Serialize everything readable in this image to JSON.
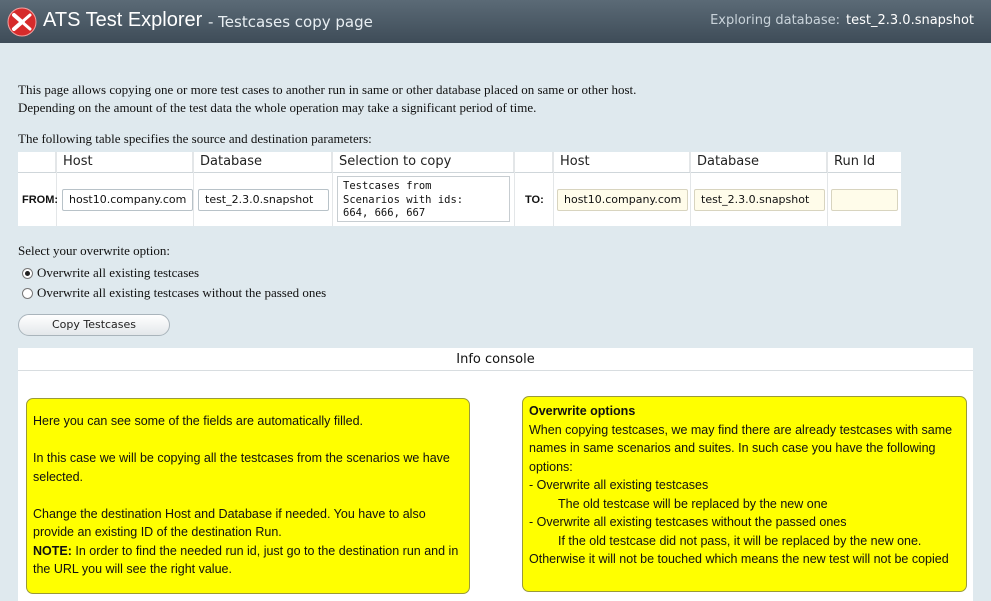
{
  "header": {
    "app_title": "ATS Test Explorer",
    "page_subtitle": "- Testcases copy page",
    "db_label": "Exploring database:",
    "db_name": "test_2.3.0.snapshot"
  },
  "intro": {
    "line1": "This page allows copying one or more test cases to another run in same or other database placed on same or other host.",
    "line2": "Depending on the amount of the test data the whole operation may take a significant period of time."
  },
  "table_caption": "The following table specifies the source and destination parameters:",
  "params": {
    "headers": {
      "src_host": "Host",
      "src_db": "Database",
      "selection": "Selection to copy",
      "dst_host": "Host",
      "dst_db": "Database",
      "run_id": "Run Id"
    },
    "from_label": "FROM:",
    "to_label": "TO:",
    "from_host": "host10.company.com",
    "from_db": "test_2.3.0.snapshot",
    "selection_text": "Testcases from\nScenarios with ids:\n664, 666, 667",
    "to_host": "host10.company.com",
    "to_db": "test_2.3.0.snapshot",
    "run_id": ""
  },
  "overwrite": {
    "title": "Select your overwrite option:",
    "options": [
      {
        "label": "Overwrite all existing testcases",
        "selected": true
      },
      {
        "label": "Overwrite all existing testcases without the passed ones",
        "selected": false
      }
    ]
  },
  "copy_button": "Copy Testcases",
  "console": {
    "title": "Info console",
    "left_note": {
      "p1": "Here you can see some of the fields are automatically filled.",
      "p2": "In this case we will be copying all the testcases from the scenarios we have selected.",
      "p3": "Change the destination Host and Database if needed. You have to also provide an existing ID of the destination Run.",
      "p4_label": "NOTE:",
      "p4_text": " In order to find the needed run id, just go to the destination run and in the URL you will see the right value."
    },
    "right_note": {
      "title": "Overwrite options",
      "intro": "When copying testcases, we may find there are already testcases with same names in same scenarios and suites. In such case you have the following options:",
      "opt1": "- Overwrite all existing testcases",
      "opt1_desc": "The old testcase will be replaced by the new one",
      "opt2": "- Overwrite all existing testcases without the passed ones",
      "opt2_desc": "If the old testcase did not pass, it will be replaced by the new one.",
      "outro": "Otherwise it will not be touched which means the new test will not be copied"
    }
  },
  "colors": {
    "header_bg": "#4a5865",
    "page_bg": "#dfe9ee",
    "note_bg": "#ffff00",
    "logo_red": "#d62b2b"
  }
}
